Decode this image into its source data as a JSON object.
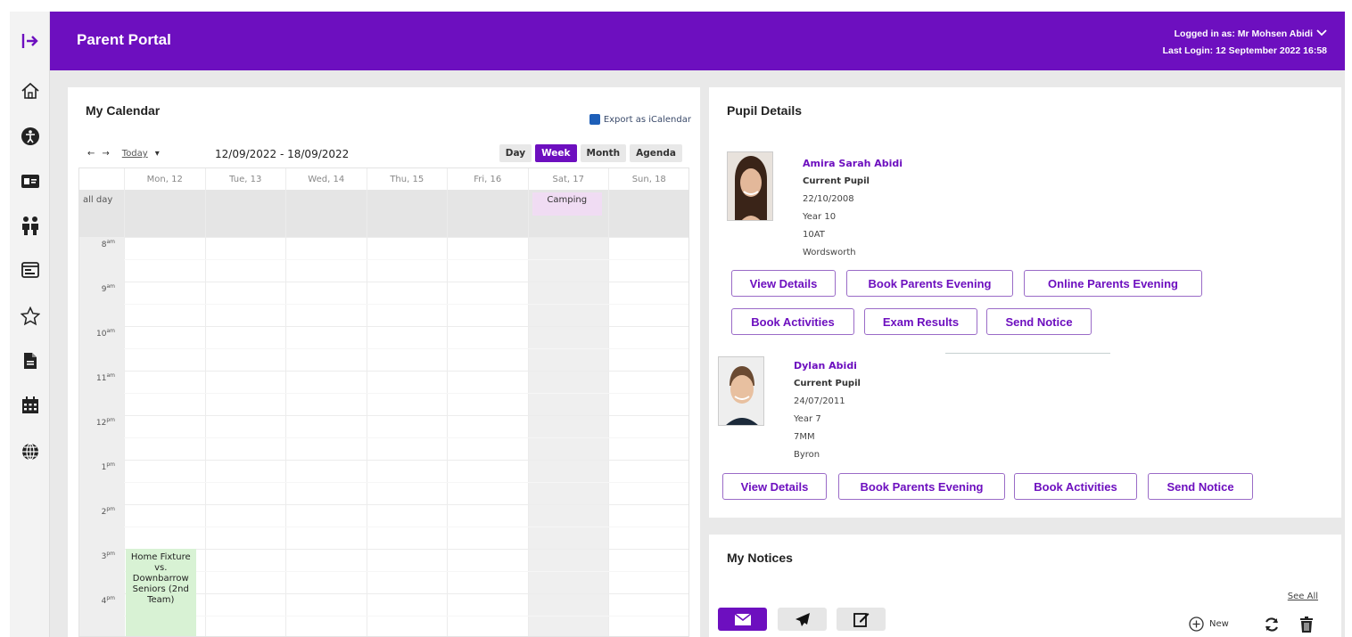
{
  "header": {
    "title": "Parent Portal",
    "logged_in": "Logged in as: Mr Mohsen Abidi",
    "last_login": "Last Login: 12 September 2022 16:58"
  },
  "rail": {
    "icons": [
      "sidebar-toggle-icon",
      "home-icon",
      "accessibility-icon",
      "id-card-icon",
      "children-icon",
      "browser-window-icon",
      "star-icon",
      "document-icon",
      "calendar-icon",
      "globe-icon"
    ]
  },
  "calendar": {
    "title": "My Calendar",
    "export_label": "Export as iCalendar",
    "nav": {
      "prev": "←",
      "next": "→",
      "today": "Today",
      "caret": "▾"
    },
    "range": "12/09/2022 - 18/09/2022",
    "views": [
      "Day",
      "Week",
      "Month",
      "Agenda"
    ],
    "active_view": "Week",
    "days": [
      "Mon, 12",
      "Tue, 13",
      "Wed, 14",
      "Thu, 15",
      "Fri, 16",
      "Sat, 17",
      "Sun, 18"
    ],
    "allday_label": "all day",
    "hours": [
      {
        "num": "8",
        "suffix": "am"
      },
      {
        "num": "9",
        "suffix": "am"
      },
      {
        "num": "10",
        "suffix": "am"
      },
      {
        "num": "11",
        "suffix": "am"
      },
      {
        "num": "12",
        "suffix": "pm"
      },
      {
        "num": "1",
        "suffix": "pm"
      },
      {
        "num": "2",
        "suffix": "pm"
      },
      {
        "num": "3",
        "suffix": "pm"
      },
      {
        "num": "4",
        "suffix": "pm"
      }
    ],
    "events": {
      "camping": "Camping",
      "home_fixture": "Home Fixture vs. Downbarrow Seniors (2nd Team)"
    }
  },
  "pupils": {
    "title": "Pupil Details",
    "list": [
      {
        "name": "Amira Sarah Abidi",
        "status": "Current Pupil",
        "dob": "22/10/2008",
        "year": "Year 10",
        "form": "10AT",
        "house": "Wordsworth",
        "buttons": [
          "View Details",
          "Book Parents Evening",
          "Online Parents Evening",
          "Book Activities",
          "Exam Results",
          "Send Notice"
        ]
      },
      {
        "name": "Dylan Abidi",
        "status": "Current Pupil",
        "dob": "24/07/2011",
        "year": "Year 7",
        "form": "7MM",
        "house": "Byron",
        "buttons": [
          "View Details",
          "Book Parents Evening",
          "Book Activities",
          "Send Notice"
        ]
      }
    ]
  },
  "notices": {
    "title": "My Notices",
    "see_all": "See All",
    "new_label": "New",
    "tabs": [
      "inbox-icon",
      "sent-icon",
      "compose-icon"
    ]
  },
  "colors": {
    "brand": "#6d0fbf",
    "event_purple": "#f0dcf3",
    "event_green": "#d8f2d4"
  }
}
